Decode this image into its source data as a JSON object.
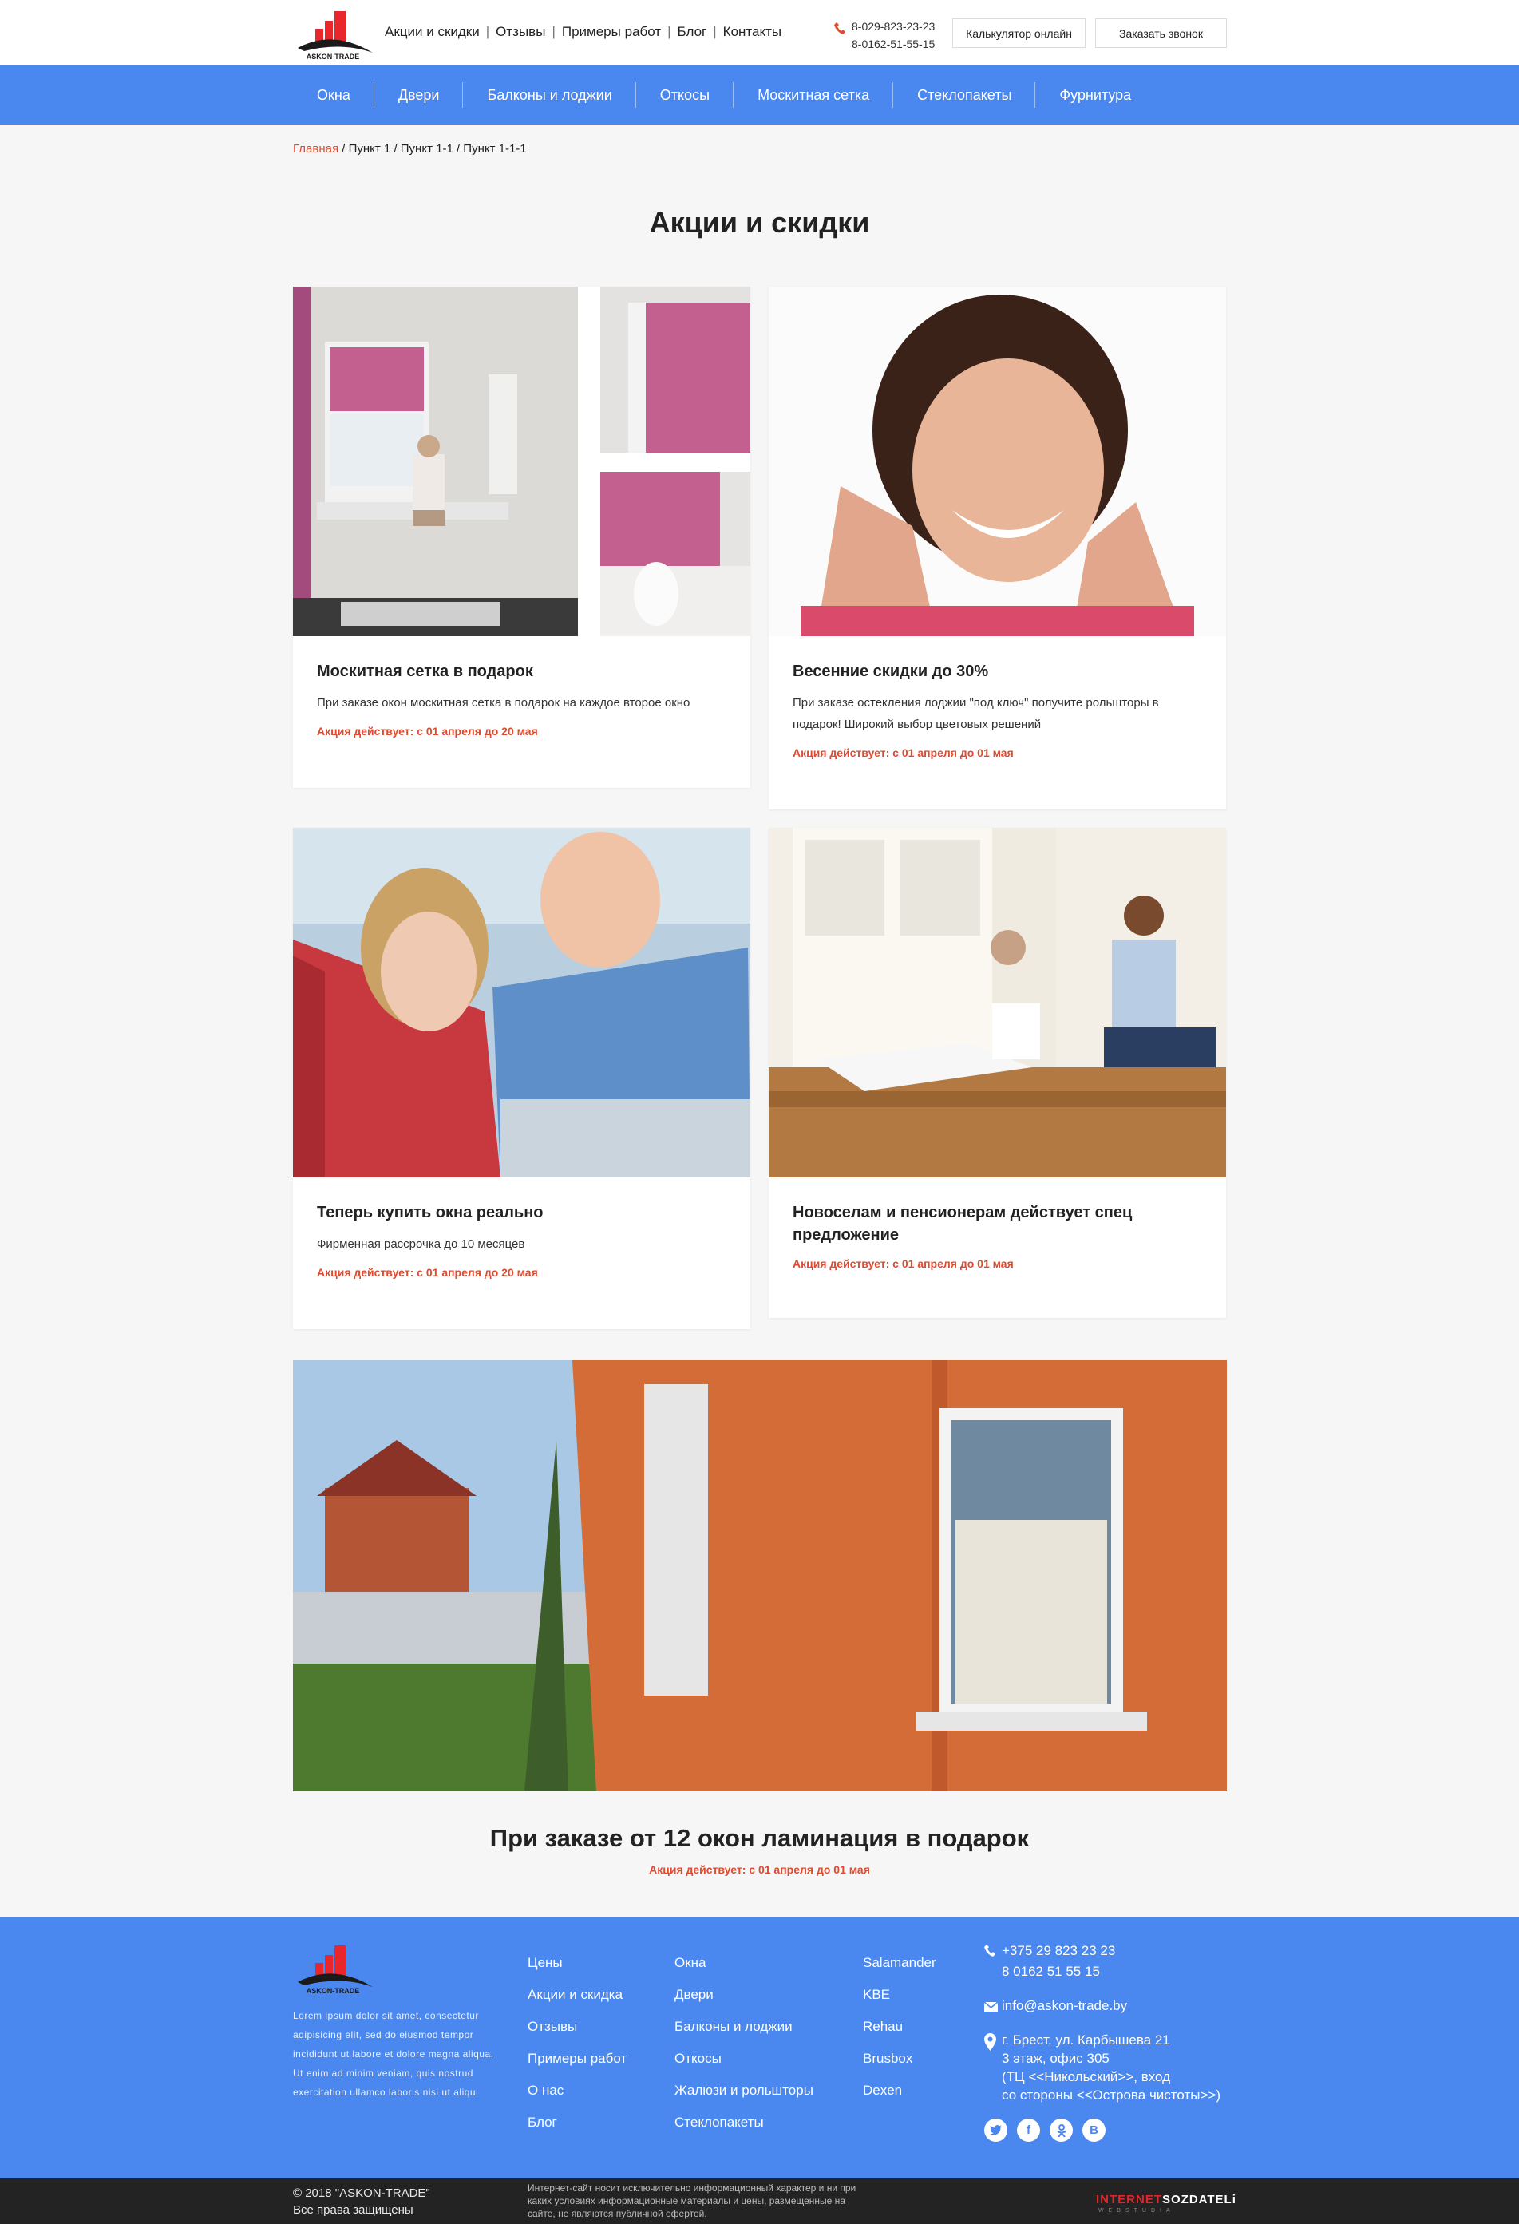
{
  "header": {
    "logo_text": "ASKON-TRADE",
    "links": [
      "Акции и скидки",
      "Отзывы",
      "Примеры работ",
      "Блог",
      "Контакты"
    ],
    "phones": [
      "8-029-823-23-23",
      "8-0162-51-55-15"
    ],
    "calc_button": "Калькулятор онлайн",
    "call_button": "Заказать звонок"
  },
  "nav": [
    "Окна",
    "Двери",
    "Балконы и лоджии",
    "Откосы",
    "Москитная сетка",
    "Стеклопакеты",
    "Фурнитура"
  ],
  "breadcrumb": {
    "home": "Главная",
    "rest": " / Пункт 1  / Пункт 1-1  / Пункт 1-1-1"
  },
  "page_title": "Акции и скидки",
  "cards": [
    {
      "title": "Москитная сетка в подарок",
      "text": "При заказе окон москитная сетка в подарок на каждое второе окно",
      "promo": "Акция действует: с 01 апреля до 20 мая"
    },
    {
      "title": "Весенние скидки до 30%",
      "text": "При заказе остекления лоджии \"под ключ\" получите рольшторы в подарок! Широкий выбор цветовых решений",
      "promo": "Акция действует: с 01 апреля до 01 мая"
    },
    {
      "title": "Теперь купить окна реально",
      "text": "Фирменная рассрочка до 10 месяцев",
      "promo": "Акция действует: с 01 апреля до 20 мая"
    },
    {
      "title": "Новоселам и пенсионерам действует спец предложение",
      "text": "",
      "promo": "Акция действует: с 01 апреля до 01 мая"
    }
  ],
  "wide_promo": {
    "title": "При заказе от 12 окон ламинация в подарок",
    "promo": "Акция действует: с 01 апреля до 01 мая"
  },
  "footer": {
    "logo_text": "ASKON-TRADE",
    "about": "Lorem ipsum dolor sit amet, consectetur adipisicing elit, sed do eiusmod tempor incididunt ut labore et dolore magna aliqua. Ut enim ad minim veniam, quis nostrud exercitation ullamco laboris nisi ut aliqui",
    "col1": [
      "Цены",
      "Акции и скидка",
      "Отзывы",
      "Примеры работ",
      "О нас",
      "Блог"
    ],
    "col2": [
      "Окна",
      "Двери",
      "Балконы и лоджии",
      "Откосы",
      "Жалюзи и рольшторы",
      "Стеклопакеты"
    ],
    "col3": [
      "Salamander",
      "KBE",
      "Rehau",
      "Brusbox",
      "Dexen"
    ],
    "phones": [
      "+375 29 823 23 23",
      "8 0162 51 55 15"
    ],
    "email": "info@askon-trade.by",
    "address": [
      "г. Брест, ул. Карбышева 21",
      "3 этаж, офис 305",
      "(ТЦ <<Никольский>>, вход",
      "со стороны <<Острова чистоты>>)"
    ],
    "socials": [
      "twitter-icon",
      "facebook-icon",
      "odnoklassniki-icon",
      "vk-icon"
    ],
    "copyright": [
      "© 2018 \"ASKON-TRADE\"",
      "Все права защищены"
    ],
    "disclaimer": "Интернет-сайт носит исключительно информационный характер и ни при каких условиях информационные материалы и цены, размещенные на сайте, не являются публичной офертой.",
    "developer_a": "INTERNET",
    "developer_b": "SOZDATELi",
    "developer_sub": "WEBSTUDIA"
  },
  "colors": {
    "accent": "#4a87ee",
    "promo": "#e04a2f",
    "dark": "#232323"
  }
}
